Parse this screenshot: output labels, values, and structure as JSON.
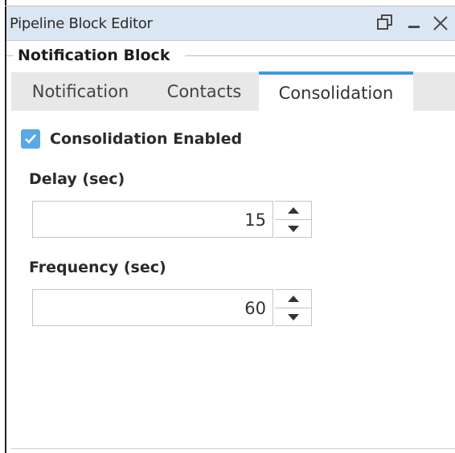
{
  "window": {
    "title": "Pipeline Block Editor",
    "controls": [
      "restore-icon",
      "minimize-icon",
      "close-icon"
    ]
  },
  "group": {
    "title": "Notification Block"
  },
  "tabs": [
    {
      "label": "Notification",
      "active": false
    },
    {
      "label": "Contacts",
      "active": false
    },
    {
      "label": "Consolidation",
      "active": true
    }
  ],
  "consolidation": {
    "enabled_label": "Consolidation Enabled",
    "enabled": true,
    "delay": {
      "label": "Delay (sec)",
      "value": "15"
    },
    "frequency": {
      "label": "Frequency (sec)",
      "value": "60"
    }
  },
  "colors": {
    "titlebar": "#dbe6f3",
    "active_tab_accent": "#3a9be0",
    "checkbox": "#5aa8e6"
  }
}
